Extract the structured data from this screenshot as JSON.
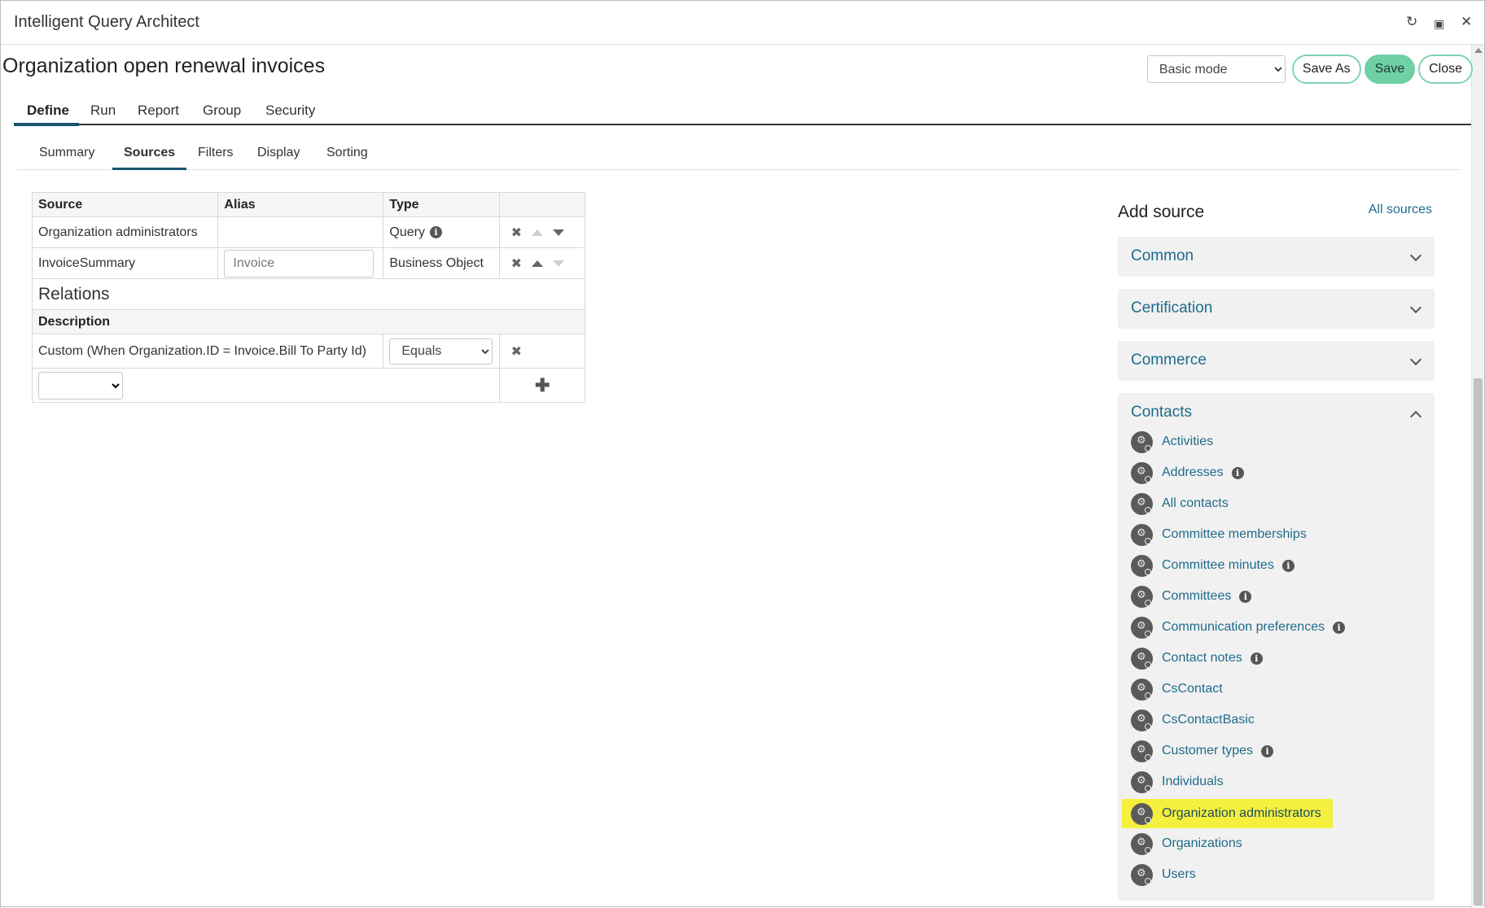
{
  "window": {
    "title": "Intelligent Query Architect"
  },
  "page": {
    "title": "Organization open renewal invoices"
  },
  "header": {
    "mode_selected": "Basic mode",
    "save_as_label": "Save As",
    "save_label": "Save",
    "close_label": "Close"
  },
  "main_tabs": [
    "Define",
    "Run",
    "Report",
    "Group",
    "Security"
  ],
  "sub_tabs": [
    "Summary",
    "Sources",
    "Filters",
    "Display",
    "Sorting"
  ],
  "sources_table": {
    "headers": {
      "source": "Source",
      "alias": "Alias",
      "type": "Type"
    },
    "rows": [
      {
        "source": "Organization administrators",
        "alias": "",
        "type": "Query"
      },
      {
        "source": "InvoiceSummary",
        "alias": "Invoice",
        "type": "Business Object"
      }
    ]
  },
  "relations": {
    "heading": "Relations",
    "description_header": "Description",
    "rows": [
      {
        "description": "Custom (When Organization.ID = Invoice.Bill To Party Id)",
        "operator": "Equals"
      }
    ]
  },
  "add_source": {
    "title": "Add source",
    "all_sources_link": "All sources",
    "groups": {
      "common": "Common",
      "certification": "Certification",
      "commerce": "Commerce",
      "contacts": "Contacts"
    },
    "contacts_items": [
      "Activities",
      "Addresses",
      "All contacts",
      "Committee memberships",
      "Committee minutes",
      "Committees",
      "Communication preferences",
      "Contact notes",
      "CsContact",
      "CsContactBasic",
      "Customer types",
      "Individuals",
      "Organization administrators",
      "Organizations",
      "Users"
    ],
    "highlight_color": "#f5ef3e"
  },
  "colors": {
    "accent": "#1f6b8c",
    "save_button": "#6fcfa5",
    "tab_underline": "#1a5570"
  }
}
